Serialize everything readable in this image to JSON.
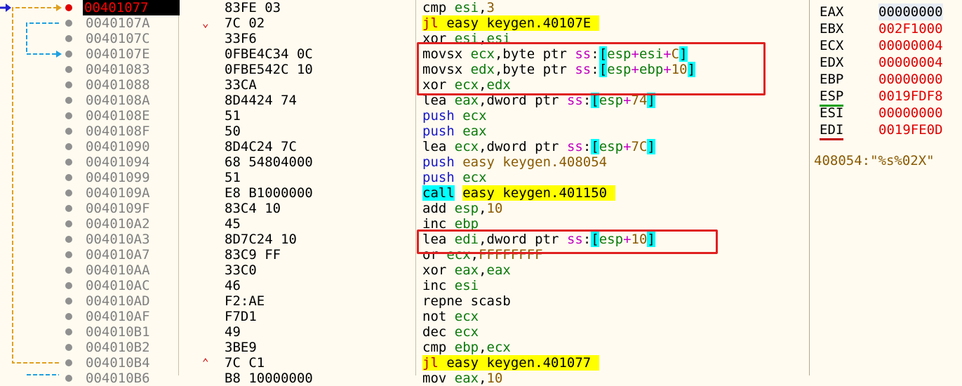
{
  "registers": [
    {
      "name": "EAX",
      "value": "00000000"
    },
    {
      "name": "EBX",
      "value": "002F1000"
    },
    {
      "name": "ECX",
      "value": "00000004"
    },
    {
      "name": "EDX",
      "value": "00000004"
    },
    {
      "name": "EBP",
      "value": "00000000"
    },
    {
      "name": "ESP",
      "value": "0019FDF8"
    },
    {
      "name": "ESI",
      "value": "00000000"
    },
    {
      "name": "EDI",
      "value": "0019FE0D"
    }
  ],
  "comment": "408054:\"%s%02X\"",
  "rows": [
    {
      "addr": "00401077",
      "bytes": "83FE 03",
      "asm": [
        [
          "cmp ",
          "k-mnem"
        ],
        [
          "esi",
          "k-reg"
        ],
        [
          ",",
          "k-mnem"
        ],
        [
          "3",
          "k-num"
        ]
      ]
    },
    {
      "addr": "0040107A",
      "bytes": "7C 02",
      "mark": "v",
      "asm": [
        [
          "jl ",
          "k-jump"
        ],
        [
          "easy keygen.40107E ",
          "k-target"
        ]
      ]
    },
    {
      "addr": "0040107C",
      "bytes": "33F6",
      "asm": [
        [
          "xor ",
          "k-mnem"
        ],
        [
          "esi",
          "k-reg"
        ],
        [
          ",",
          "k-mnem"
        ],
        [
          "esi",
          "k-reg"
        ]
      ]
    },
    {
      "addr": "0040107E",
      "bytes": "0FBE4C34 0C",
      "asm": [
        [
          "movsx ",
          "k-mnem"
        ],
        [
          "ecx",
          "k-reg"
        ],
        [
          ",byte ptr ",
          "k-ptr"
        ],
        [
          "ss",
          "k-seg"
        ],
        [
          ":",
          "k-mnem"
        ],
        [
          "[",
          "k-br"
        ],
        [
          "esp",
          "k-reg"
        ],
        [
          "+",
          "k-seg"
        ],
        [
          "esi",
          "k-reg"
        ],
        [
          "+",
          "k-seg"
        ],
        [
          "C",
          "k-num"
        ],
        [
          "]",
          "k-br"
        ]
      ]
    },
    {
      "addr": "00401083",
      "bytes": "0FBE542C 10",
      "asm": [
        [
          "movsx ",
          "k-mnem"
        ],
        [
          "edx",
          "k-reg"
        ],
        [
          ",byte ptr ",
          "k-ptr"
        ],
        [
          "ss",
          "k-seg"
        ],
        [
          ":",
          "k-mnem"
        ],
        [
          "[",
          "k-br"
        ],
        [
          "esp",
          "k-reg"
        ],
        [
          "+",
          "k-seg"
        ],
        [
          "ebp",
          "k-reg"
        ],
        [
          "+",
          "k-seg"
        ],
        [
          "10",
          "k-num"
        ],
        [
          "]",
          "k-br"
        ]
      ]
    },
    {
      "addr": "00401088",
      "bytes": "33CA",
      "asm": [
        [
          "xor ",
          "k-mnem"
        ],
        [
          "ecx",
          "k-reg"
        ],
        [
          ",",
          "k-mnem"
        ],
        [
          "edx",
          "k-reg"
        ]
      ]
    },
    {
      "addr": "0040108A",
      "bytes": "8D4424 74",
      "asm": [
        [
          "lea ",
          "k-mnem"
        ],
        [
          "eax",
          "k-reg"
        ],
        [
          ",dword ptr ",
          "k-ptr"
        ],
        [
          "ss",
          "k-seg"
        ],
        [
          ":",
          "k-mnem"
        ],
        [
          "[",
          "k-br"
        ],
        [
          "esp",
          "k-reg"
        ],
        [
          "+",
          "k-seg"
        ],
        [
          "74",
          "k-num"
        ],
        [
          "]",
          "k-br"
        ]
      ]
    },
    {
      "addr": "0040108E",
      "bytes": "51",
      "asm": [
        [
          "push ",
          "k-push"
        ],
        [
          "ecx",
          "k-reg"
        ]
      ]
    },
    {
      "addr": "0040108F",
      "bytes": "50",
      "asm": [
        [
          "push ",
          "k-push"
        ],
        [
          "eax",
          "k-reg"
        ]
      ]
    },
    {
      "addr": "00401090",
      "bytes": "8D4C24 7C",
      "asm": [
        [
          "lea ",
          "k-mnem"
        ],
        [
          "ecx",
          "k-reg"
        ],
        [
          ",dword ptr ",
          "k-ptr"
        ],
        [
          "ss",
          "k-seg"
        ],
        [
          ":",
          "k-mnem"
        ],
        [
          "[",
          "k-br"
        ],
        [
          "esp",
          "k-reg"
        ],
        [
          "+",
          "k-seg"
        ],
        [
          "7C",
          "k-num"
        ],
        [
          "]",
          "k-br"
        ]
      ]
    },
    {
      "addr": "00401094",
      "bytes": "68 54804000",
      "asm": [
        [
          "push ",
          "k-push"
        ],
        [
          "easy keygen.408054",
          "k-num"
        ]
      ]
    },
    {
      "addr": "00401099",
      "bytes": "51",
      "asm": [
        [
          "push ",
          "k-push"
        ],
        [
          "ecx",
          "k-reg"
        ]
      ]
    },
    {
      "addr": "0040109A",
      "bytes": "E8 B1000000",
      "asm": [
        [
          "call",
          "k-call"
        ],
        [
          " ",
          "k-mnem"
        ],
        [
          "easy keygen.401150 ",
          "k-target"
        ]
      ]
    },
    {
      "addr": "0040109F",
      "bytes": "83C4 10",
      "asm": [
        [
          "add ",
          "k-mnem"
        ],
        [
          "esp",
          "k-reg"
        ],
        [
          ",",
          "k-mnem"
        ],
        [
          "10",
          "k-num"
        ]
      ]
    },
    {
      "addr": "004010A2",
      "bytes": "45",
      "asm": [
        [
          "inc ",
          "k-mnem"
        ],
        [
          "ebp",
          "k-reg"
        ]
      ]
    },
    {
      "addr": "004010A3",
      "bytes": "8D7C24 10",
      "asm": [
        [
          "lea ",
          "k-mnem"
        ],
        [
          "edi",
          "k-reg"
        ],
        [
          ",dword ptr ",
          "k-ptr"
        ],
        [
          "ss",
          "k-seg"
        ],
        [
          ":",
          "k-mnem"
        ],
        [
          "[",
          "k-br"
        ],
        [
          "esp",
          "k-reg"
        ],
        [
          "+",
          "k-seg"
        ],
        [
          "10",
          "k-num"
        ],
        [
          "]",
          "k-br"
        ]
      ]
    },
    {
      "addr": "004010A7",
      "bytes": "83C9 FF",
      "asm": [
        [
          "or ",
          "k-mnem"
        ],
        [
          "ecx",
          "k-reg"
        ],
        [
          ",",
          "k-mnem"
        ],
        [
          "FFFFFFFF",
          "k-num"
        ]
      ]
    },
    {
      "addr": "004010AA",
      "bytes": "33C0",
      "asm": [
        [
          "xor ",
          "k-mnem"
        ],
        [
          "eax",
          "k-reg"
        ],
        [
          ",",
          "k-mnem"
        ],
        [
          "eax",
          "k-reg"
        ]
      ]
    },
    {
      "addr": "004010AC",
      "bytes": "46",
      "asm": [
        [
          "inc ",
          "k-mnem"
        ],
        [
          "esi",
          "k-reg"
        ]
      ]
    },
    {
      "addr": "004010AD",
      "bytes": "F2:AE",
      "asm": [
        [
          "repne scasb",
          "k-mnem"
        ]
      ]
    },
    {
      "addr": "004010AF",
      "bytes": "F7D1",
      "asm": [
        [
          "not ",
          "k-mnem"
        ],
        [
          "ecx",
          "k-reg"
        ]
      ]
    },
    {
      "addr": "004010B1",
      "bytes": "49",
      "asm": [
        [
          "dec ",
          "k-mnem"
        ],
        [
          "ecx",
          "k-reg"
        ]
      ]
    },
    {
      "addr": "004010B2",
      "bytes": "3BE9",
      "asm": [
        [
          "cmp ",
          "k-mnem"
        ],
        [
          "ebp",
          "k-reg"
        ],
        [
          ",",
          "k-mnem"
        ],
        [
          "ecx",
          "k-reg"
        ]
      ]
    },
    {
      "addr": "004010B4",
      "bytes": "7C C1",
      "mark": "^",
      "asm": [
        [
          "jl ",
          "k-jump"
        ],
        [
          "easy keygen.401077 ",
          "k-target"
        ]
      ]
    },
    {
      "addr": "004010B6",
      "bytes": "B8 10000000",
      "asm": [
        [
          "mov ",
          "k-mnem"
        ],
        [
          "eax",
          "k-reg"
        ],
        [
          ",",
          "k-mnem"
        ],
        [
          "10",
          "k-num"
        ]
      ]
    }
  ],
  "colors": {
    "background": "#fffbf0",
    "highlight_box": "#e02020",
    "breakpoint": "#e00000"
  }
}
